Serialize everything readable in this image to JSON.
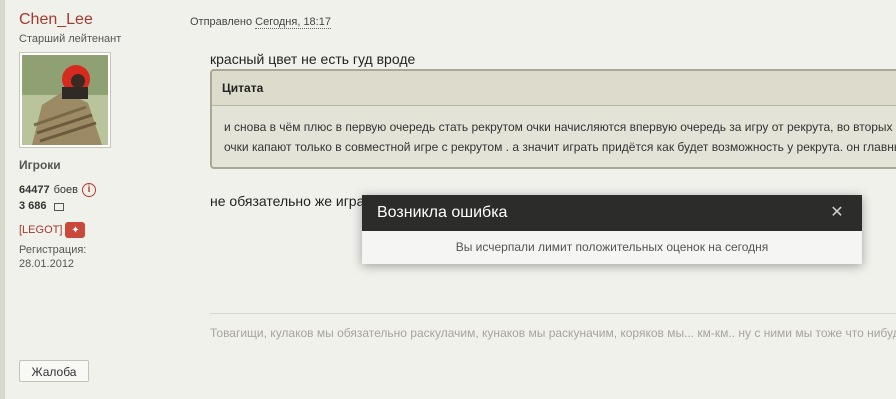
{
  "author": {
    "name": "Chen_Lee",
    "rank": "Старший лейтенант",
    "group": "Игроки",
    "battles_value": "64477",
    "battles_label": "боев",
    "posts": "3 686",
    "clan": "[LEGOT]",
    "registration_label": "Регистрация:",
    "registration_date": "28.01.2012",
    "complaint_label": "Жалоба"
  },
  "post": {
    "sent_label": "Отправлено",
    "sent_time": "Сегодня, 18:17",
    "text": "красный цвет не есть гуд вроде",
    "quote_title": "Цитата",
    "quote_line1": "и снова в чём плюс в первую очередь стать рекрутом очки начисляются впервую очередь за игру от рекрута, во вторых",
    "quote_line2": "очки капают только в совместной игре с рекрутом . а значит играть придётся как будет возможность у рекрута. он главны",
    "text2": "не обязательно же игра",
    "signature": "Товагищи, кулаков мы обязательно раскулачим, кунаков мы раскуначим, коряков мы... км-км.. ну с ними мы тоже что нибудь п"
  },
  "dialog": {
    "title": "Возникла ошибка",
    "message": "Вы исчерпали лимит положительных оценок на сегодня",
    "close_glyph": "✕"
  },
  "colors": {
    "author_name": "#a33a2c",
    "dialog_header": "#2c2c2a",
    "page_bg": "#f1f1ec"
  }
}
